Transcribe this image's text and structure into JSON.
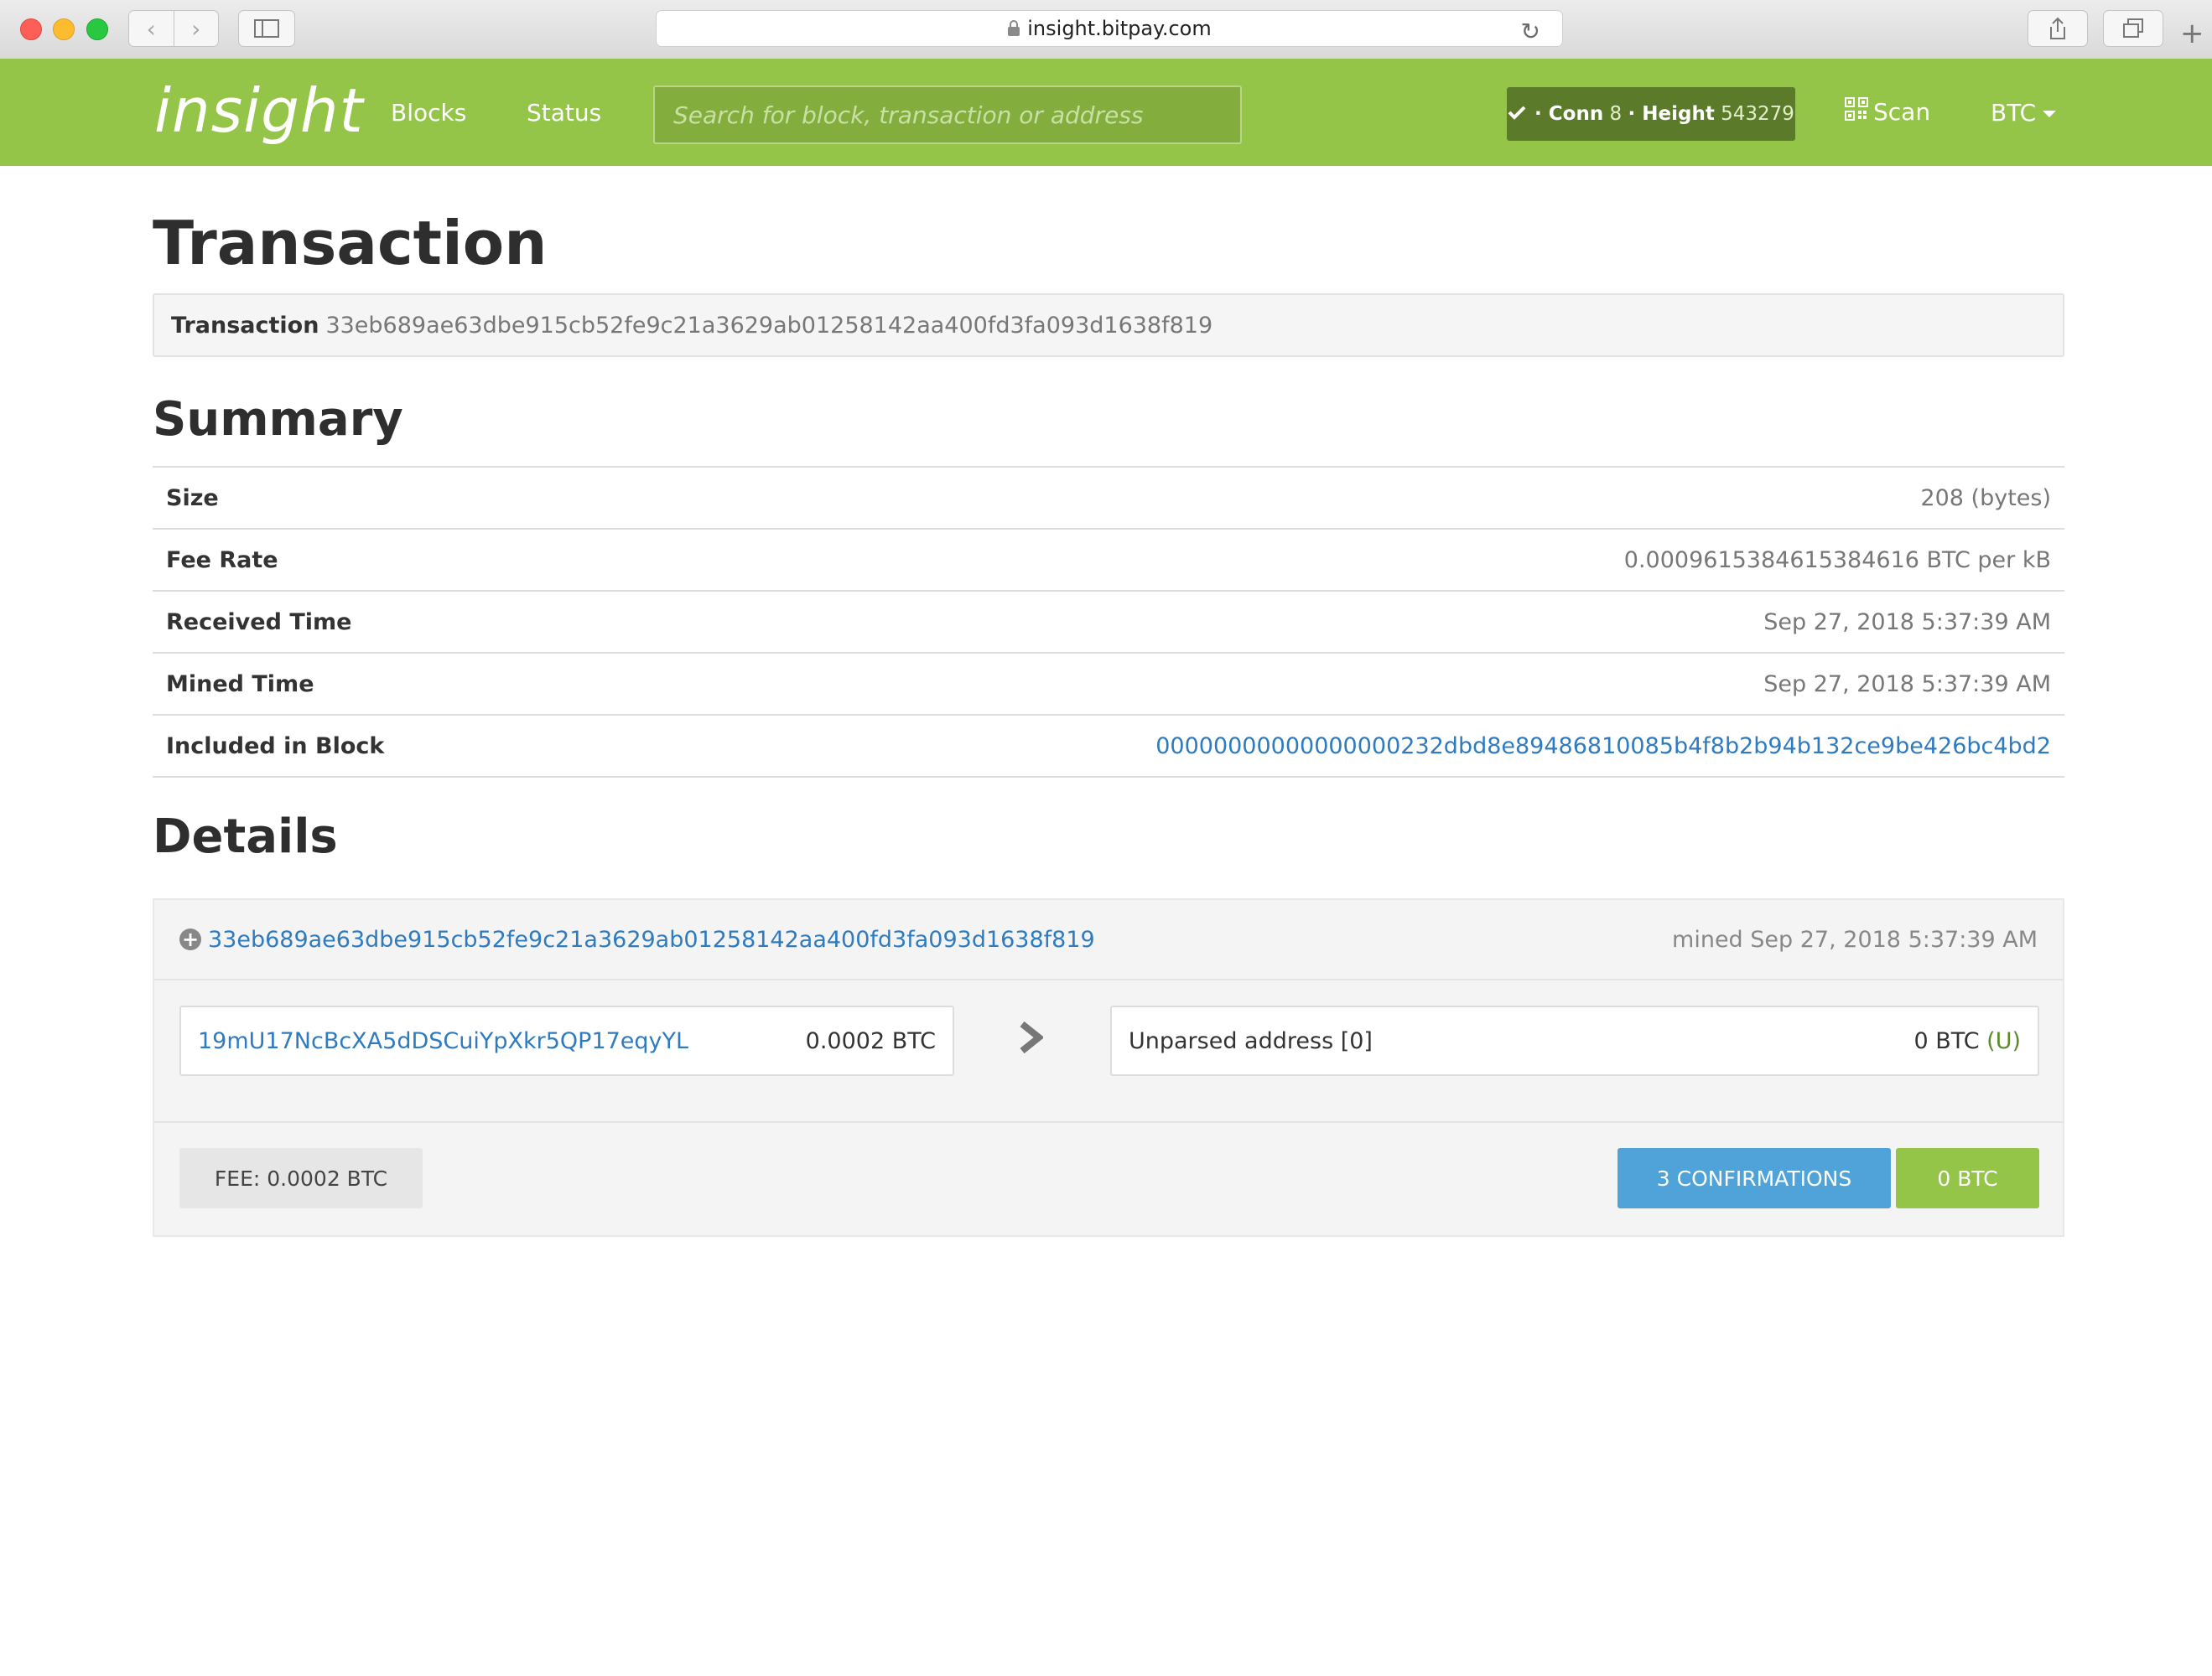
{
  "browser": {
    "url": "insight.bitpay.com"
  },
  "navbar": {
    "brand": "insight",
    "links": [
      "Blocks",
      "Status"
    ],
    "search_placeholder": "Search for block, transaction or address",
    "conn_prefix": "· Conn",
    "conn_count": "8",
    "height_label": "· Height",
    "height_value": "543279",
    "scan_label": "Scan",
    "currency": "BTC"
  },
  "page": {
    "title": "Transaction",
    "tx_label": "Transaction",
    "tx_id": "33eb689ae63dbe915cb52fe9c21a3629ab01258142aa400fd3fa093d1638f819"
  },
  "summary": {
    "title": "Summary",
    "rows": [
      {
        "label": "Size",
        "value": "208 (bytes)"
      },
      {
        "label": "Fee Rate",
        "value": "0.0009615384615384616 BTC per kB"
      },
      {
        "label": "Received Time",
        "value": "Sep 27, 2018 5:37:39 AM"
      },
      {
        "label": "Mined Time",
        "value": "Sep 27, 2018 5:37:39 AM"
      },
      {
        "label": "Included in Block",
        "value": "00000000000000000232dbd8e89486810085b4f8b2b94b132ce9be426bc4bd2"
      }
    ]
  },
  "details": {
    "title": "Details",
    "tx_id": "33eb689ae63dbe915cb52fe9c21a3629ab01258142aa400fd3fa093d1638f819",
    "mined": "mined Sep 27, 2018 5:37:39 AM",
    "input": {
      "address": "19mU17NcBcXA5dDSCuiYpXkr5QP17eqyYL",
      "amount": "0.0002 BTC"
    },
    "output": {
      "address": "Unparsed address [0]",
      "amount": "0 BTC",
      "flag": "(U)"
    },
    "fee": "FEE: 0.0002 BTC",
    "confirmations": "3 CONFIRMATIONS",
    "total": "0 BTC"
  },
  "colors": {
    "brand_green": "#94c548",
    "link_blue": "#2f7bbf",
    "confirm_blue": "#4fa3d8"
  }
}
